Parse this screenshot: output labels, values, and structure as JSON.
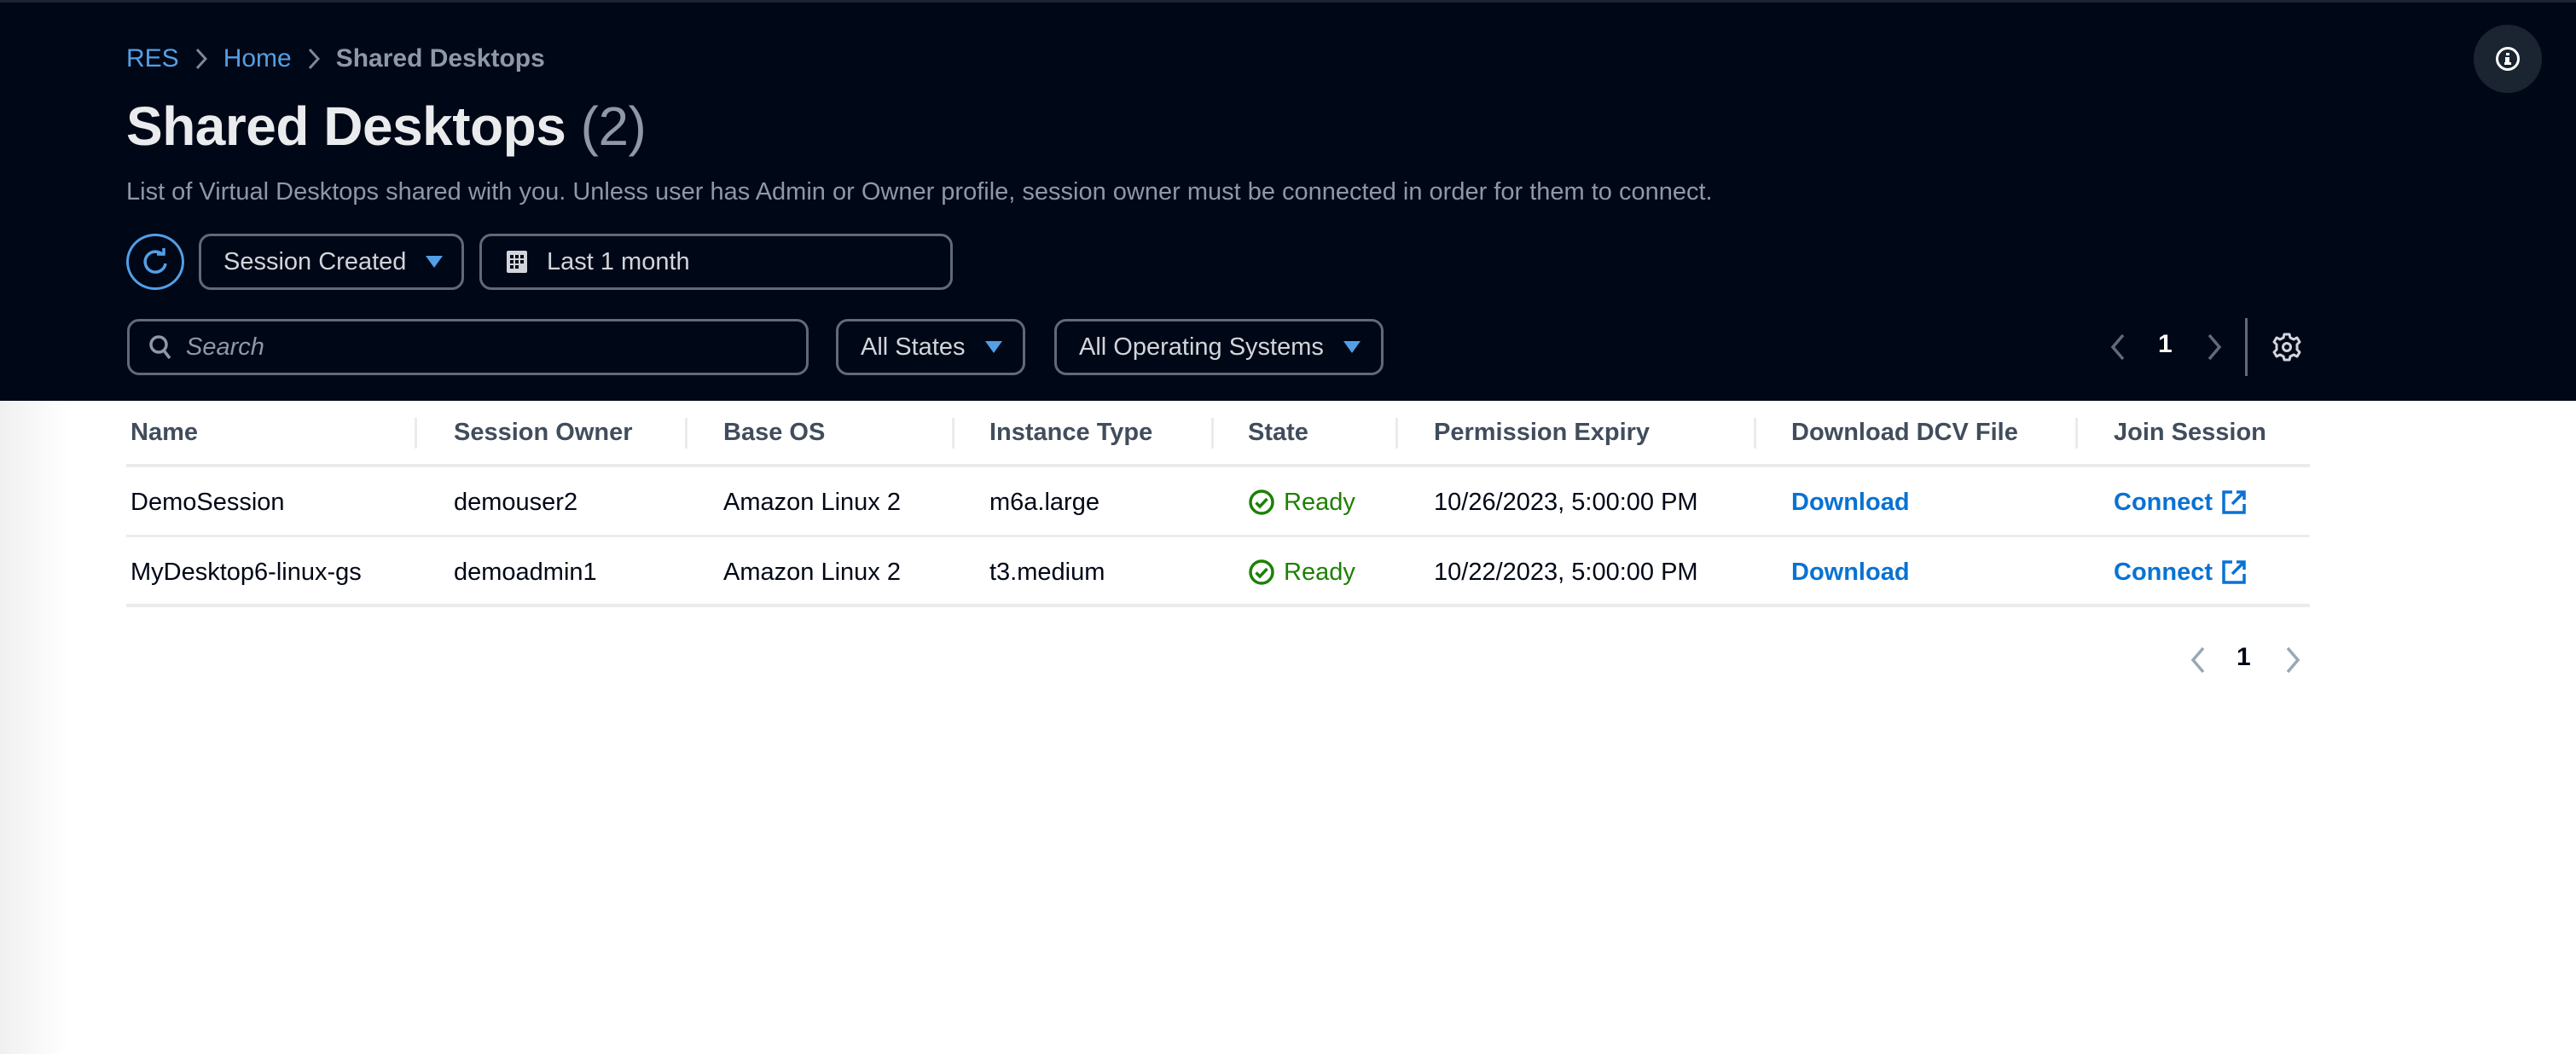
{
  "breadcrumb": [
    {
      "label": "RES",
      "link": true
    },
    {
      "label": "Home",
      "link": true
    },
    {
      "label": "Shared Desktops",
      "link": false
    }
  ],
  "header": {
    "title": "Shared Desktops",
    "count": "(2)",
    "description": "List of Virtual Desktops shared with you. Unless user has Admin or Owner profile, session owner must be connected in order for them to connect."
  },
  "filters": {
    "sort_by": "Session Created",
    "date_range": "Last 1 month",
    "search_placeholder": "Search",
    "search_value": "",
    "state_filter": "All States",
    "os_filter": "All Operating Systems"
  },
  "pagination": {
    "current_page": "1"
  },
  "colors": {
    "header_bg": "#000716",
    "accent": "#539fe5",
    "link": "#0972d3",
    "status_ready": "#1d8102"
  },
  "table": {
    "columns": [
      "Name",
      "Session Owner",
      "Base OS",
      "Instance Type",
      "State",
      "Permission Expiry",
      "Download DCV File",
      "Join Session"
    ],
    "rows": [
      {
        "name": "DemoSession",
        "owner": "demouser2",
        "base_os": "Amazon Linux 2",
        "instance_type": "m6a.large",
        "state": "Ready",
        "permission_expiry": "10/26/2023, 5:00:00 PM",
        "download": "Download",
        "join": "Connect"
      },
      {
        "name": "MyDesktop6-linux-gs",
        "owner": "demoadmin1",
        "base_os": "Amazon Linux 2",
        "instance_type": "t3.medium",
        "state": "Ready",
        "permission_expiry": "10/22/2023, 5:00:00 PM",
        "download": "Download",
        "join": "Connect"
      }
    ]
  }
}
